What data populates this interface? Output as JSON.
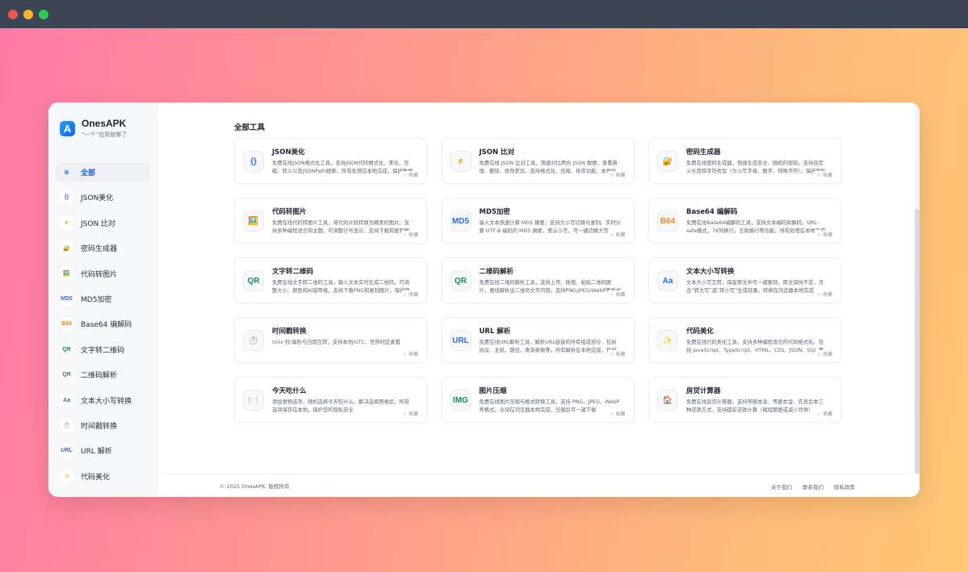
{
  "brand": {
    "name": "OnesAPK",
    "tagline": "“一个”应用就够了",
    "logo_letter": "A"
  },
  "sidebar": {
    "items": [
      {
        "label": "全部",
        "icon": "⚙",
        "color": "#3d6fe0",
        "active": true
      },
      {
        "label": "JSON美化",
        "icon": "{}",
        "color": "#2f6fd6"
      },
      {
        "label": "JSON 比对",
        "icon": "≠",
        "color": "#e0a22a"
      },
      {
        "label": "密码生成器",
        "icon": "🔐",
        "color": "#c89c2a"
      },
      {
        "label": "代码转图片",
        "icon": "🖼️",
        "color": "#5a8f3a"
      },
      {
        "label": "MD5加密",
        "icon": "MD5",
        "color": "#2f6fd6"
      },
      {
        "label": "Base64 编解码",
        "icon": "B64",
        "color": "#e88a1a"
      },
      {
        "label": "文字转二维码",
        "icon": "QR",
        "color": "#1f8a4a"
      },
      {
        "label": "二维码解析",
        "icon": "QR",
        "color": "#1f8a4a"
      },
      {
        "label": "文本大小写转换",
        "icon": "Aa",
        "color": "#2f6fd6"
      },
      {
        "label": "时间戳转换",
        "icon": "⏱️",
        "color": "#2f6fd6"
      },
      {
        "label": "URL 解析",
        "icon": "URL",
        "color": "#2f6fd6"
      },
      {
        "label": "代码美化",
        "icon": "✨",
        "color": "#d4a017"
      },
      {
        "label": "今天吃什么",
        "icon": "🍽️",
        "color": "#6b7280"
      }
    ]
  },
  "main": {
    "section_title": "全部工具",
    "fav_label": "☆ 收藏",
    "cards": [
      {
        "title": "JSON美化",
        "icon": "{}",
        "color": "#2f6fd6",
        "desc": "免费在线JSON格式化工具，支持JSON代码格式化、美化、压缩、转义以及JSONPath搜索。所有处理在本地完成，保护数据安全"
      },
      {
        "title": "JSON 比对",
        "icon": "≠",
        "color": "#e0a22a",
        "desc": "免费在线 JSON 比对工具，快速对比两份 JSON 数据，查看新增、删除、修改差异。支持格式化、压缩、排序功能，本地处理"
      },
      {
        "title": "密码生成器",
        "icon": "🔐",
        "color": "#c89c2a",
        "desc": "免费在线密码生成器，快速生成安全、随机的密码。支持自定义长度和字符类型（大小写字母、数字、特殊字符），保护隐私"
      },
      {
        "title": "代码转图片",
        "icon": "🖼️",
        "color": "#5a8f3a",
        "desc": "免费在线代码转图片工具，将代码片段转换为精美的图片。支持多种编程语言和主题，可调整行号显示，支持下载和复制图片"
      },
      {
        "title": "MD5加密",
        "icon": "MD5",
        "color": "#2f6fd6",
        "desc": "输入文本快速计算 MD5 摘要，支持大小写切换与复制。实时计算 UTF-8 编码的 MD5 摘要，默认小写，可一键切换大写"
      },
      {
        "title": "Base64 编解码",
        "icon": "B64",
        "color": "#e88a1a",
        "desc": "免费在线Base64编解码工具，支持文本编码和解码，URL-safe模式，76列换行，去除换行等功能。所有处理在本地完成"
      },
      {
        "title": "文字转二维码",
        "icon": "QR",
        "color": "#1f8a4a",
        "desc": "免费在线文字转二维码工具，输入文本实时生成二维码。可调整大小、颜色和纠错等级，支持下载PNG和复制图片，保护隐私"
      },
      {
        "title": "二维码解析",
        "icon": "QR",
        "color": "#1f8a4a",
        "desc": "免费在线二维码解析工具，支持上传、拖拽、粘贴二维码图片，离线解析出二维码文字内容。支持PNG/JPEG/WebP等格式"
      },
      {
        "title": "文本大小写转换",
        "icon": "Aa",
        "color": "#2f6fd6",
        "desc": "文本大小写互转，保留原文并可一键复制。原文保持不变，点击“转大写”或“转小写”生成结果。转换在浏览器本地完成"
      },
      {
        "title": "时间戳转换",
        "icon": "⏱️",
        "color": "#2f6fd6",
        "desc": "Unix 秒/毫秒与日期互转，支持本地/UTC、世界时区查看"
      },
      {
        "title": "URL 解析",
        "icon": "URL",
        "color": "#2f6fd6",
        "desc": "免费在线URL解析工具，解析URL链接的所有组成部分，包括协议、主机、路径、查询参数等。所有解析在本地完成，保护隐私"
      },
      {
        "title": "代码美化",
        "icon": "✨",
        "color": "#d4a017",
        "desc": "免费在线代码美化工具，支持多种编程语言的代码格式化。包括 JavaScript、TypeScript、HTML、CSS、JSON、SQL 等"
      },
      {
        "title": "今天吃什么",
        "icon": "🍽️",
        "color": "#6b7280",
        "desc": "添加食物选项，随机选择今天吃什么，解决选择困难症。所有选项保存在本地，保护您的隐私安全"
      },
      {
        "title": "图片压缩",
        "icon": "IMG",
        "color": "#1f8a4a",
        "desc": "免费在线图片压缩与格式转换工具，支持 PNG、JPEG、WebP 等格式。全部在浏览器本地完成，压缩后可一键下载"
      },
      {
        "title": "房贷计算器",
        "icon": "🏠",
        "color": "#c0392b",
        "desc": "免费在线房贷计算器，支持等额本息、等额本金、先息后本三种还款方式，支持提前还款计算（缩短期限或减少月供）"
      }
    ]
  },
  "footer": {
    "copyright": "© 2025 OnesAPK. 版权所有",
    "links": [
      "关于我们",
      "联系我们",
      "隐私政策"
    ]
  }
}
